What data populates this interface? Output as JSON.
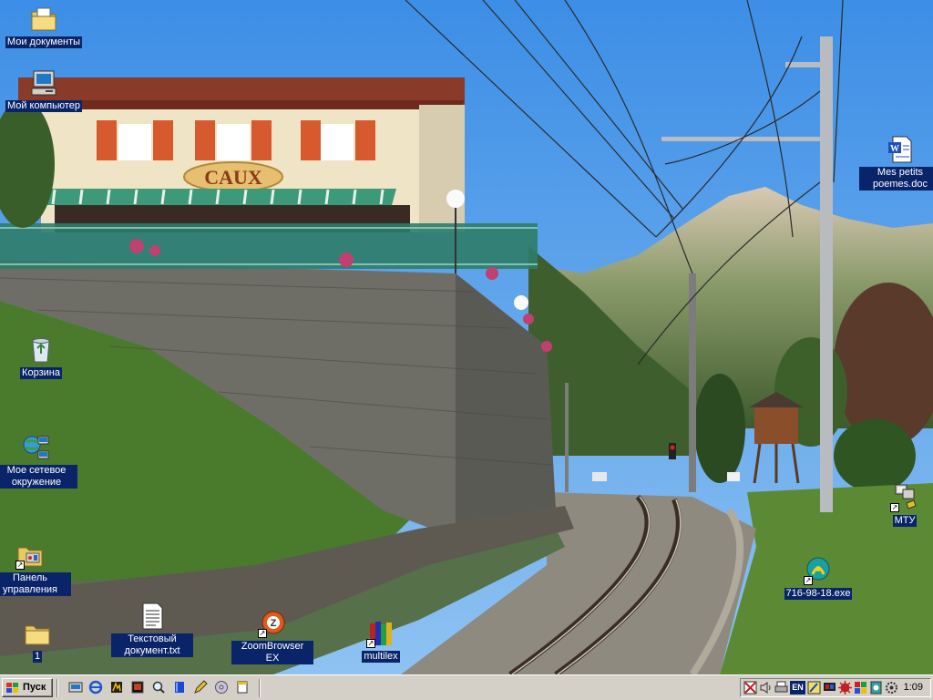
{
  "desktop": {
    "icons": [
      {
        "label": "Мои документы",
        "icon": "folder-documents-icon"
      },
      {
        "label": "Мой компьютер",
        "icon": "my-computer-icon"
      },
      {
        "label": "Корзина",
        "icon": "recycle-bin-icon"
      },
      {
        "label": "Мое сетевое окружение",
        "icon": "network-icon"
      },
      {
        "label": "Панель управления",
        "icon": "control-panel-icon"
      },
      {
        "label": "1",
        "icon": "folder-icon"
      },
      {
        "label": "Текстовый документ.txt",
        "icon": "text-file-icon"
      },
      {
        "label": "ZoomBrowser EX",
        "icon": "zoombrowser-icon"
      },
      {
        "label": "multilex",
        "icon": "books-icon"
      },
      {
        "label": "Mes petits poemes.doc",
        "icon": "word-doc-icon"
      },
      {
        "label": "МТУ",
        "icon": "network-shortcut-icon"
      },
      {
        "label": "716-98-18.exe",
        "icon": "dialup-exe-icon"
      }
    ]
  },
  "wallpaper": {
    "sign_text": "CAUX",
    "colors": {
      "sky": "#5a9fe8",
      "house": "#f0e6c8",
      "shutters": "#d65a2e",
      "railing": "#3a8a78",
      "grass": "#4c7a2c"
    }
  },
  "taskbar": {
    "start_label": "Пуск",
    "quick_launch": [
      "show-desktop-icon",
      "internet-explorer-icon",
      "winamp-icon",
      "media-icon",
      "search-icon",
      "book-icon",
      "pencil-icon",
      "cd-icon",
      "notepad-icon"
    ],
    "tray": {
      "icons": [
        "flag-icon",
        "volume-icon",
        "printer-icon",
        "language-icon",
        "pen-icon",
        "monitor-icon",
        "antivirus-icon",
        "network-tray-icon",
        "clock-tray-icon",
        "settings-tray-icon"
      ],
      "language": "EN",
      "time": "1:09"
    }
  }
}
